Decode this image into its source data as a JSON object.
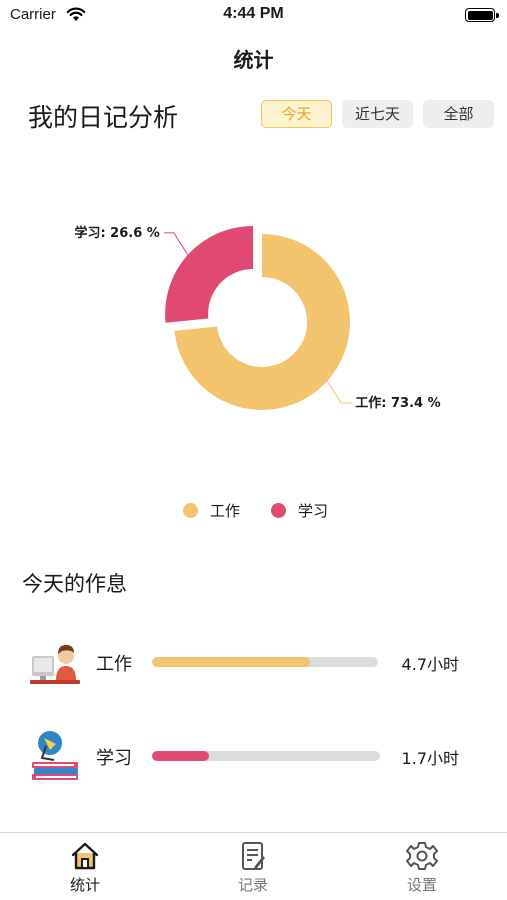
{
  "status_bar": {
    "carrier": "Carrier",
    "time": "4:44 PM"
  },
  "nav": {
    "title": "统计"
  },
  "analysis": {
    "title": "我的日记分析",
    "segments": [
      {
        "label": "今天",
        "selected": true
      },
      {
        "label": "近七天",
        "selected": false
      },
      {
        "label": "全部",
        "selected": false
      }
    ]
  },
  "chart_data": {
    "type": "pie",
    "variant": "donut",
    "categories": [
      "工作",
      "学习"
    ],
    "values": [
      73.4,
      26.6
    ],
    "labels": [
      "工作: 73.4 %",
      "学习: 26.6 %"
    ],
    "colors": [
      "#f2c46d",
      "#e04a72"
    ],
    "highlighted_slice": "学习",
    "legend": [
      "工作",
      "学习"
    ],
    "legend_position": "bottom"
  },
  "routine": {
    "title": "今天的作息",
    "items": [
      {
        "label": "工作",
        "value": "4.7小时",
        "progress": 0.7,
        "color": "#f2c46d",
        "icon": "computer-worker-icon"
      },
      {
        "label": "学习",
        "value": "1.7小时",
        "progress": 0.25,
        "color": "#e04a72",
        "icon": "study-lamp-books-icon"
      }
    ]
  },
  "tabs": [
    {
      "label": "统计",
      "icon": "home-icon",
      "active": true
    },
    {
      "label": "记录",
      "icon": "notes-edit-icon",
      "active": false
    },
    {
      "label": "设置",
      "icon": "gear-icon",
      "active": false
    }
  ],
  "colors": {
    "accent": "#f2c46d",
    "accent_text": "#e3a52a",
    "study": "#e04a72",
    "track": "#dcdcdc"
  }
}
